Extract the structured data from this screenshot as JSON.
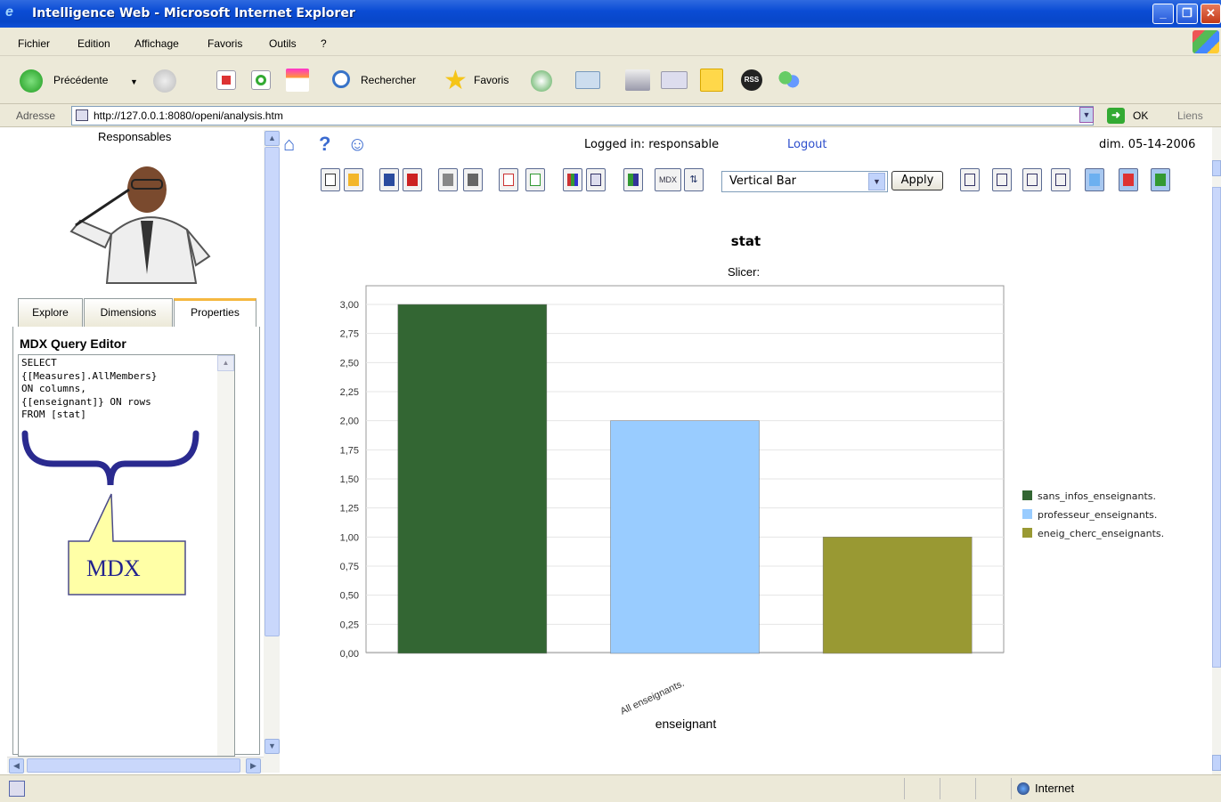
{
  "window": {
    "title": "Intelligence Web - Microsoft Internet Explorer"
  },
  "menu": [
    "Fichier",
    "Edition",
    "Affichage",
    "Favoris",
    "Outils",
    "?"
  ],
  "toolbar": {
    "back": "Précédente",
    "search": "Rechercher",
    "favorites": "Favoris"
  },
  "address": {
    "label": "Adresse",
    "url": "http://127.0.0.1:8080/openi/analysis.htm",
    "go": "OK",
    "links": "Liens"
  },
  "left_panel": {
    "title": "Responsables",
    "tabs": [
      "Explore",
      "Dimensions",
      "Properties"
    ],
    "active_tab": "Properties",
    "editor_title": "MDX Query Editor",
    "query": "SELECT\n{[Measures].AllMembers}\nON columns,\n{[enseignant]} ON rows\nFROM [stat]",
    "callout": "MDX"
  },
  "header": {
    "logged_in": "Logged in:  responsable",
    "logout": "Logout",
    "date": "dim. 05-14-2006"
  },
  "analysis_toolbar": {
    "chart_type": "Vertical Bar",
    "apply": "Apply"
  },
  "colors": {
    "accent": "#0a4cd4",
    "series1": "#336633",
    "series2": "#99ccff",
    "series3": "#999933"
  },
  "chart_data": {
    "type": "bar",
    "title": "stat",
    "subtitle": "Slicer:",
    "xlabel": "enseignant",
    "ylabel": "",
    "categories": [
      "All enseignants."
    ],
    "series": [
      {
        "name": "sans_infos_enseignants.",
        "values": [
          3.0
        ],
        "color": "#336633"
      },
      {
        "name": "professeur_enseignants.",
        "values": [
          2.0
        ],
        "color": "#99ccff"
      },
      {
        "name": "eneig_cherc_enseignants.",
        "values": [
          1.0
        ],
        "color": "#999933"
      }
    ],
    "ylim": [
      0,
      3.0
    ],
    "yticks": [
      "0,00",
      "0,25",
      "0,50",
      "0,75",
      "1,00",
      "1,25",
      "1,50",
      "1,75",
      "2,00",
      "2,25",
      "2,50",
      "2,75",
      "3,00"
    ],
    "grid": true,
    "legend": "right"
  },
  "status": {
    "zone": "Internet"
  }
}
